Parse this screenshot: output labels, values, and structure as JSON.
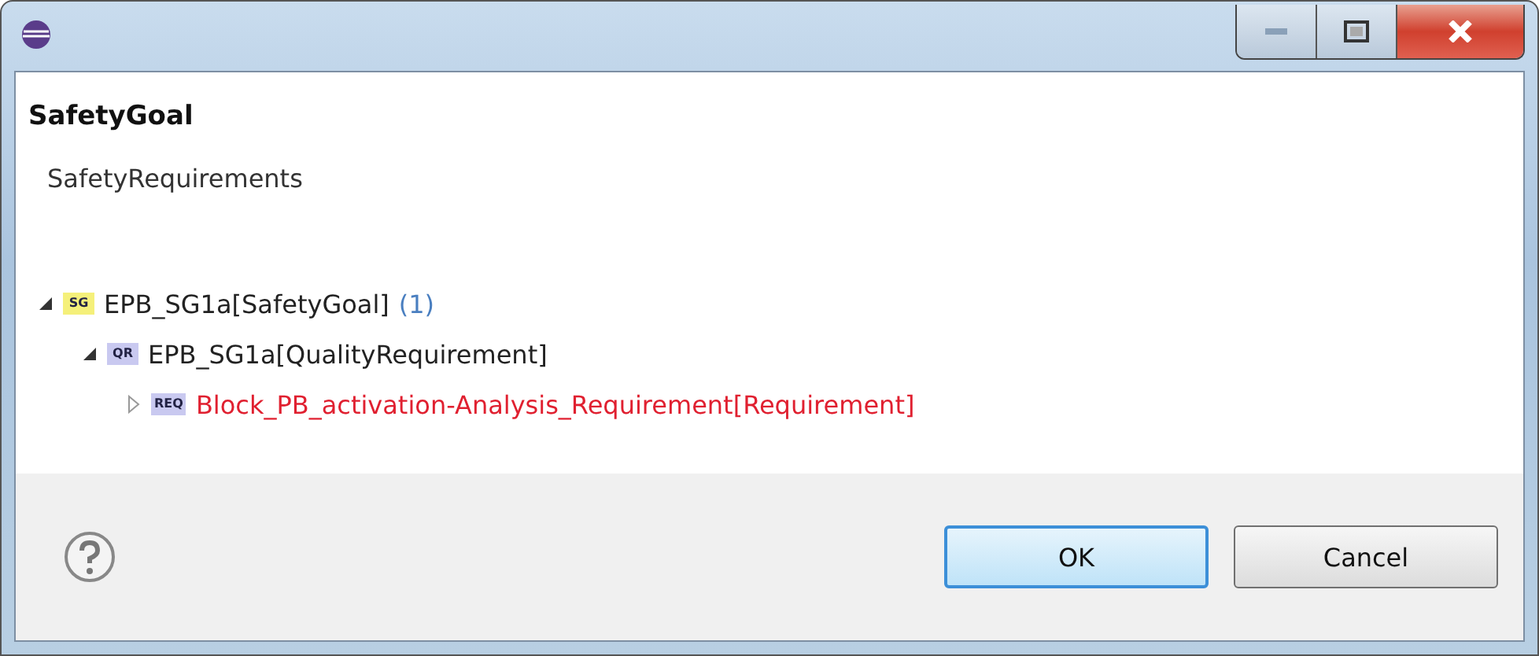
{
  "header": {
    "title": "SafetyGoal",
    "subtitle": "SafetyRequirements"
  },
  "tree": [
    {
      "badge": "SG",
      "kind": "goal",
      "label": "EPB_SG1a[SafetyGoal]",
      "count": "(1)",
      "expanded": true,
      "color": "#222222",
      "children": [
        {
          "badge": "QR",
          "kind": "quality",
          "label": "EPB_SG1a[QualityRequirement]",
          "expanded": true,
          "color": "#222222",
          "children": [
            {
              "badge": "REQ",
              "kind": "requirement",
              "label": "Block_PB_activation-Analysis_Requirement[Requirement]",
              "expanded": false,
              "color": "#e02030"
            }
          ]
        }
      ]
    }
  ],
  "buttons": [
    {
      "label": "OK",
      "default": true
    },
    {
      "label": "Cancel",
      "default": false
    }
  ]
}
